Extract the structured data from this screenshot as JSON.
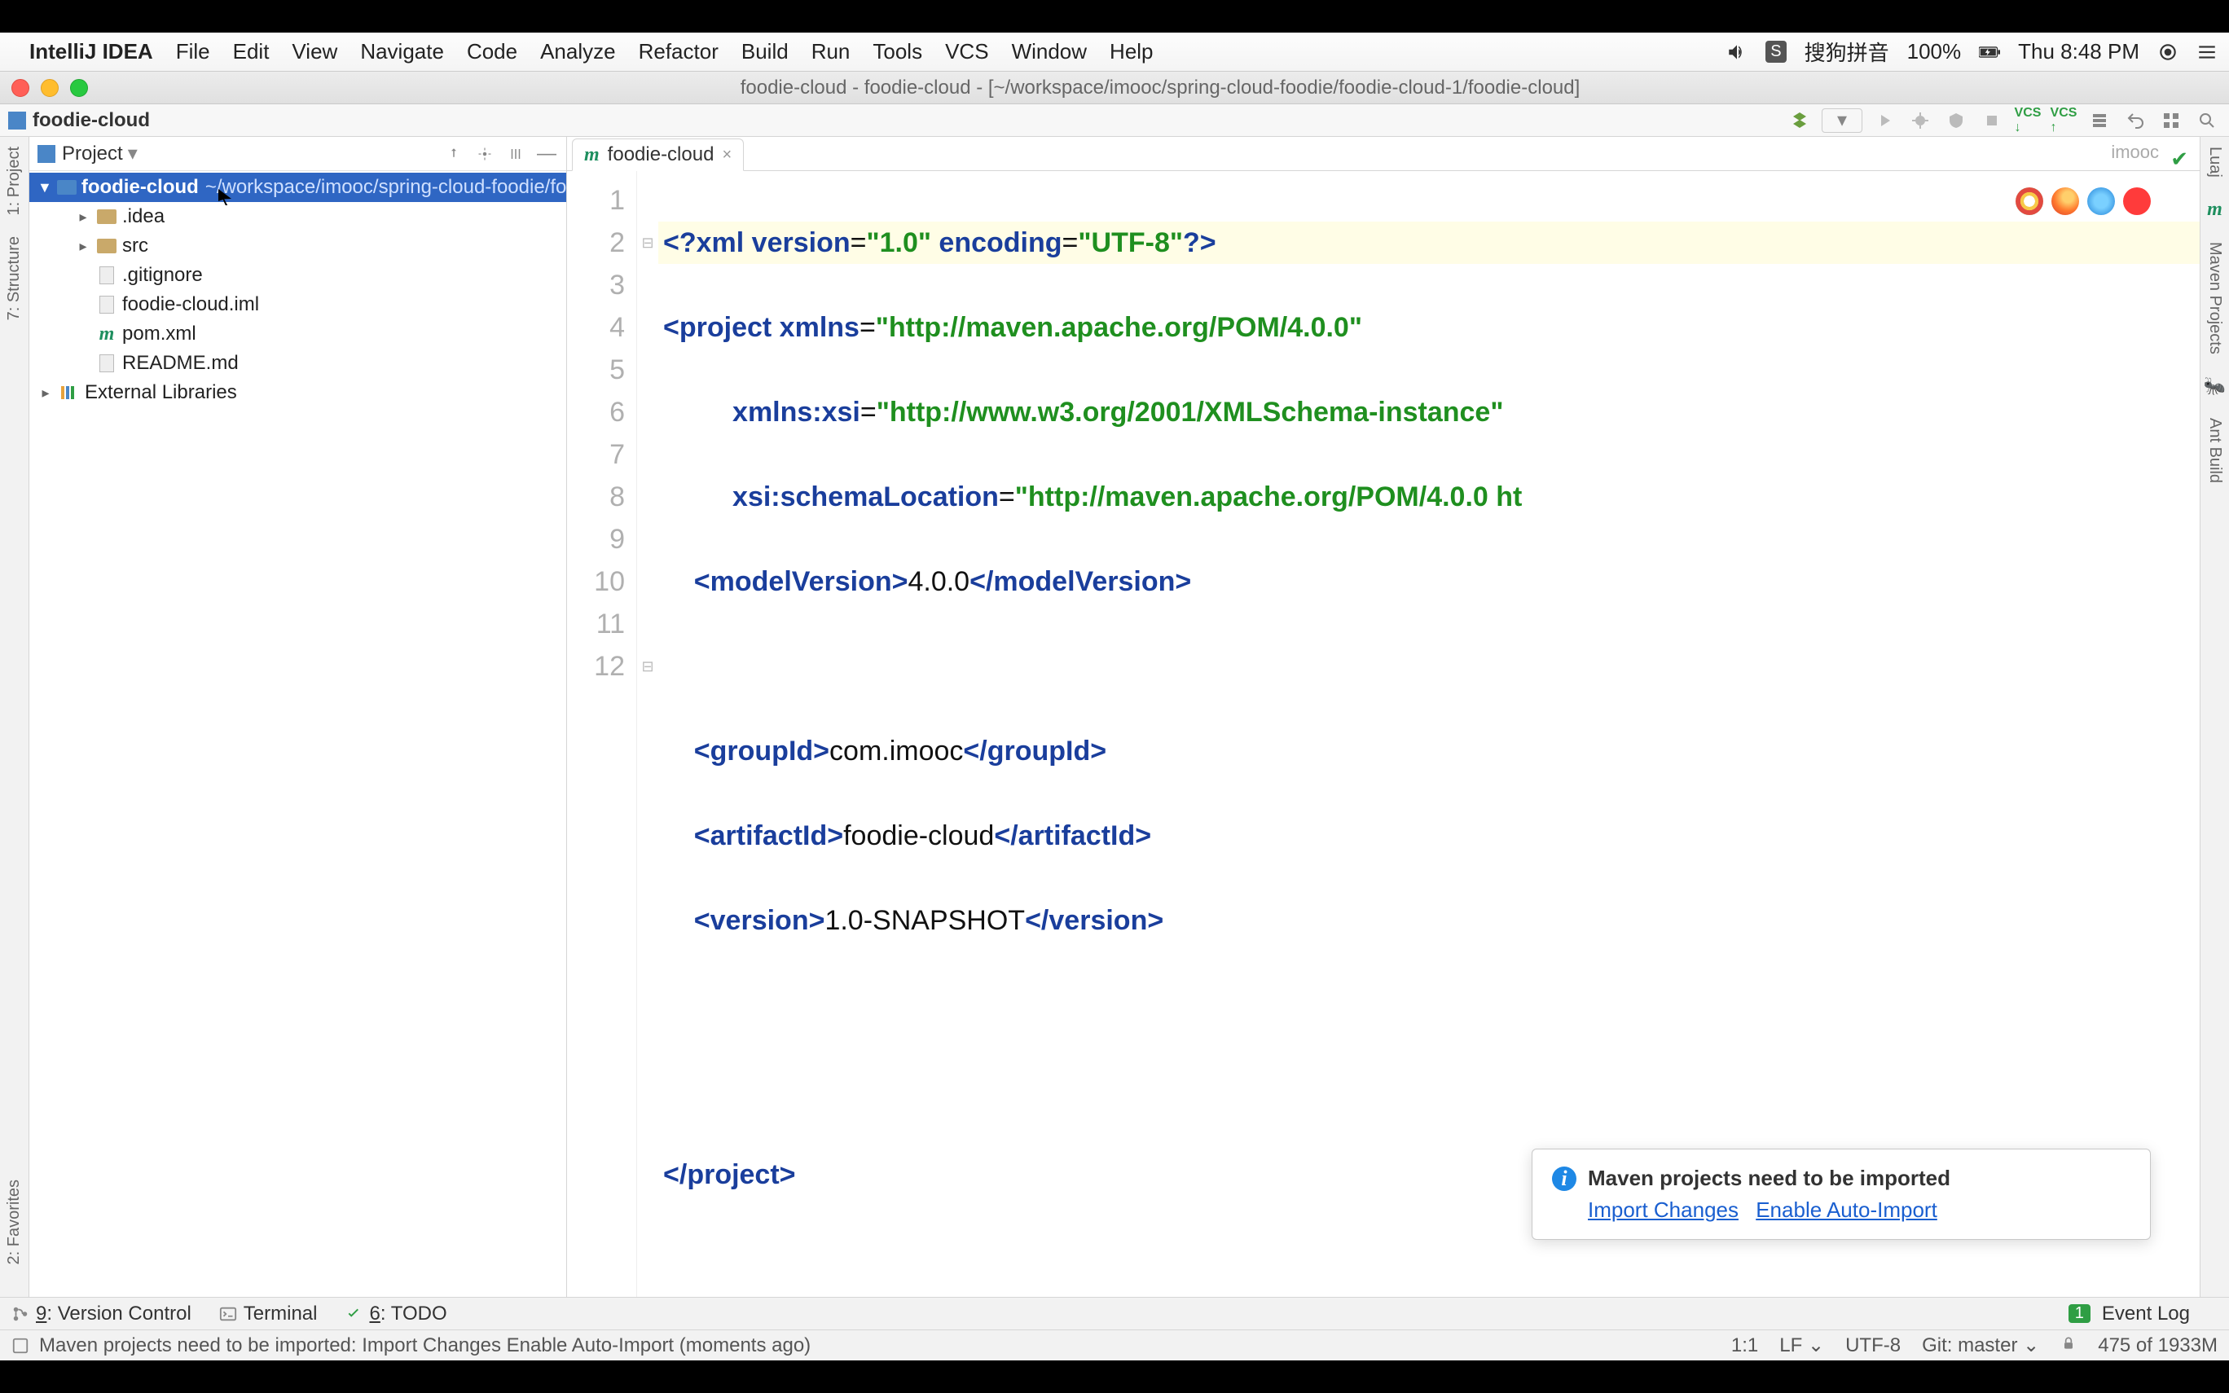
{
  "mac_menu": {
    "app": "IntelliJ IDEA",
    "items": [
      "File",
      "Edit",
      "View",
      "Navigate",
      "Code",
      "Analyze",
      "Refactor",
      "Build",
      "Run",
      "Tools",
      "VCS",
      "Window",
      "Help"
    ],
    "ime": "搜狗拼音",
    "battery": "100%",
    "clock": "Thu 8:48 PM"
  },
  "window_title": "foodie-cloud - foodie-cloud - [~/workspace/imooc/spring-cloud-foodie/foodie-cloud-1/foodie-cloud]",
  "breadcrumb": "foodie-cloud",
  "project_panel": {
    "title": "Project",
    "root": {
      "name": "foodie-cloud",
      "path": "~/workspace/imooc/spring-cloud-foodie/foodie-cloud-1/foodie-cloud"
    },
    "children": [
      {
        "name": ".idea",
        "type": "folder",
        "expandable": true
      },
      {
        "name": "src",
        "type": "folder",
        "expandable": true
      },
      {
        "name": ".gitignore",
        "type": "file"
      },
      {
        "name": "foodie-cloud.iml",
        "type": "file"
      },
      {
        "name": "pom.xml",
        "type": "maven"
      },
      {
        "name": "README.md",
        "type": "file"
      }
    ],
    "external": "External Libraries"
  },
  "left_rail": {
    "project": "1: Project",
    "structure": "7: Structure",
    "favorites": "2: Favorites"
  },
  "right_rail": {
    "maven": "Maven Projects",
    "ant": "Ant Build",
    "lua": "Luaj"
  },
  "editor": {
    "tab": "foodie-cloud",
    "crumb": "imooc",
    "lines": [
      "1",
      "2",
      "3",
      "4",
      "5",
      "6",
      "7",
      "8",
      "9",
      "10",
      "11",
      "12"
    ],
    "code": {
      "l1a": "<?",
      "l1b": "xml version",
      "l1c": "=",
      "l1d": "\"1.0\"",
      "l1e": " encoding",
      "l1f": "=",
      "l1g": "\"UTF-8\"",
      "l1h": "?>",
      "l2a": "<",
      "l2b": "project ",
      "l2c": "xmlns",
      "l2d": "=",
      "l2e": "\"http://maven.apache.org/POM/4.0.0\"",
      "l3a": "         ",
      "l3b": "xmlns:xsi",
      "l3c": "=",
      "l3d": "\"http://www.w3.org/2001/XMLSchema-instance\"",
      "l4a": "         ",
      "l4b": "xsi:schemaLocation",
      "l4c": "=",
      "l4d": "\"http://maven.apache.org/POM/4.0.0 ht",
      "l5a": "    <",
      "l5b": "modelVersion",
      "l5c": ">",
      "l5d": "4.0.0",
      "l5e": "</",
      "l5f": "modelVersion",
      "l5g": ">",
      "l7a": "    <",
      "l7b": "groupId",
      "l7c": ">",
      "l7d": "com.imooc",
      "l7e": "</",
      "l7f": "groupId",
      "l7g": ">",
      "l8a": "    <",
      "l8b": "artifactId",
      "l8c": ">",
      "l8d": "foodie-cloud",
      "l8e": "</",
      "l8f": "artifactId",
      "l8g": ">",
      "l9a": "    <",
      "l9b": "version",
      "l9c": ">",
      "l9d": "1.0-SNAPSHOT",
      "l9e": "</",
      "l9f": "version",
      "l9g": ">",
      "l12a": "</",
      "l12b": "project",
      "l12c": ">"
    }
  },
  "notification": {
    "title": "Maven projects need to be imported",
    "link1": "Import Changes",
    "link2": "Enable Auto-Import"
  },
  "bottom": {
    "vcs": "9: Version Control",
    "terminal": "Terminal",
    "todo": "6: TODO",
    "event_count": "1",
    "event": "Event Log"
  },
  "status": {
    "msg": "Maven projects need to be imported: Import Changes Enable Auto-Import (moments ago)",
    "pos": "1:1",
    "le": "LF",
    "enc": "UTF-8",
    "git": "Git: master",
    "mem": "475 of 1933M"
  }
}
